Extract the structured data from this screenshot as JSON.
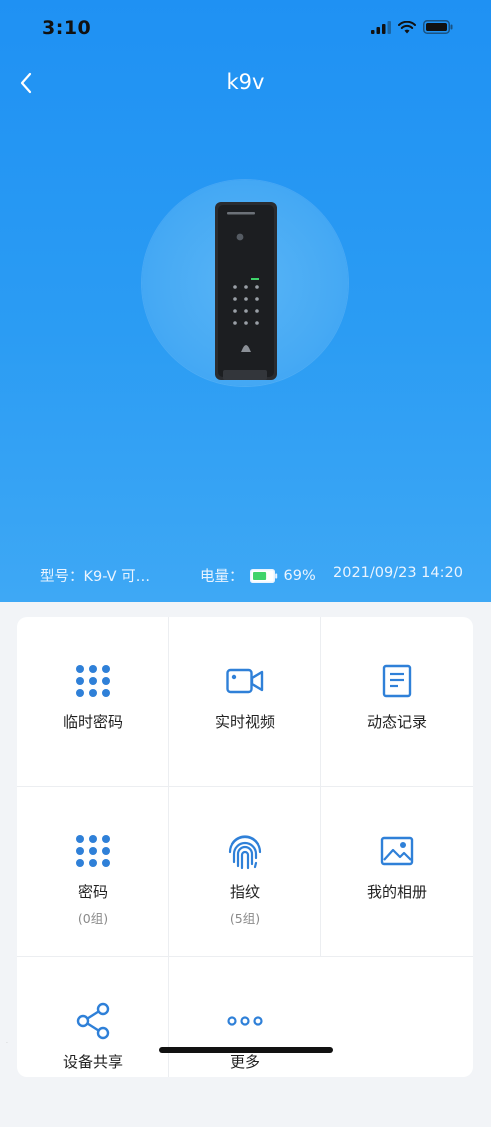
{
  "status_bar": {
    "time": "3:10"
  },
  "header": {
    "title": "k9v"
  },
  "device_info": {
    "model": "型号：K9-V 可…",
    "battery_label": "电量：",
    "battery_percent": "69%",
    "battery_level": 0.69,
    "datetime": "2021/09/23 14:20"
  },
  "menu": [
    {
      "label": "临时密码",
      "sub": "",
      "icon": "dots-grid-icon"
    },
    {
      "label": "实时视频",
      "sub": "",
      "icon": "video-camera-icon"
    },
    {
      "label": "动态记录",
      "sub": "",
      "icon": "document-icon"
    },
    {
      "label": "密码",
      "sub": "(0组)",
      "icon": "keypad-icon"
    },
    {
      "label": "指纹",
      "sub": "(5组)",
      "icon": "fingerprint-icon"
    },
    {
      "label": "我的相册",
      "sub": "",
      "icon": "image-icon"
    },
    {
      "label": "设备共享",
      "sub": "",
      "icon": "share-icon"
    },
    {
      "label": "更多",
      "sub": "",
      "icon": "more-icon"
    }
  ],
  "colors": {
    "accent": "#2b9cf3",
    "icon": "#2f80d8"
  }
}
